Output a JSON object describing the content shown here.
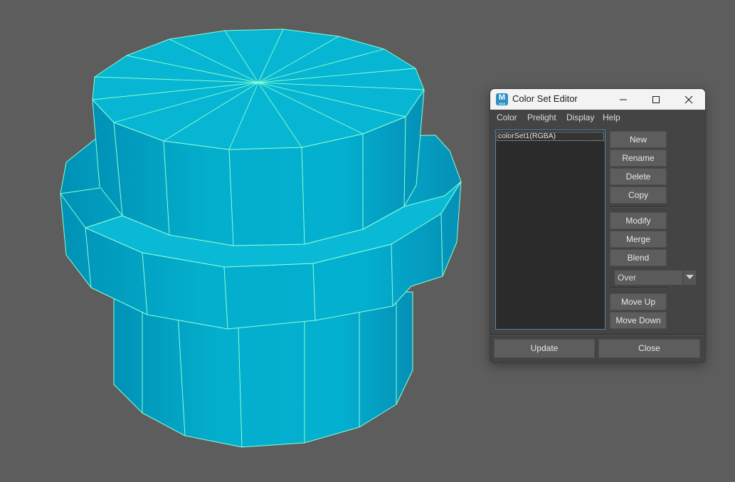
{
  "viewport": {
    "object": "polygon-cylinder-with-ring",
    "mesh_color": "#06b4d0",
    "edge_color": "#8affd6",
    "background_color": "#5d5d5d"
  },
  "window": {
    "title": "Color Set Editor",
    "app_icon": {
      "letter": "M",
      "sub": "2024"
    },
    "menu": [
      "Color",
      "Prelight",
      "Display",
      "Help"
    ],
    "color_sets": [
      "colorSet1(RGBA)"
    ],
    "buttons_group1": [
      "New",
      "Rename",
      "Delete",
      "Copy"
    ],
    "buttons_group2": [
      "Modify",
      "Merge",
      "Blend"
    ],
    "blend_mode": "Over",
    "buttons_group3": [
      "Move Up",
      "Move Down"
    ],
    "footer": {
      "update": "Update",
      "close": "Close"
    }
  }
}
